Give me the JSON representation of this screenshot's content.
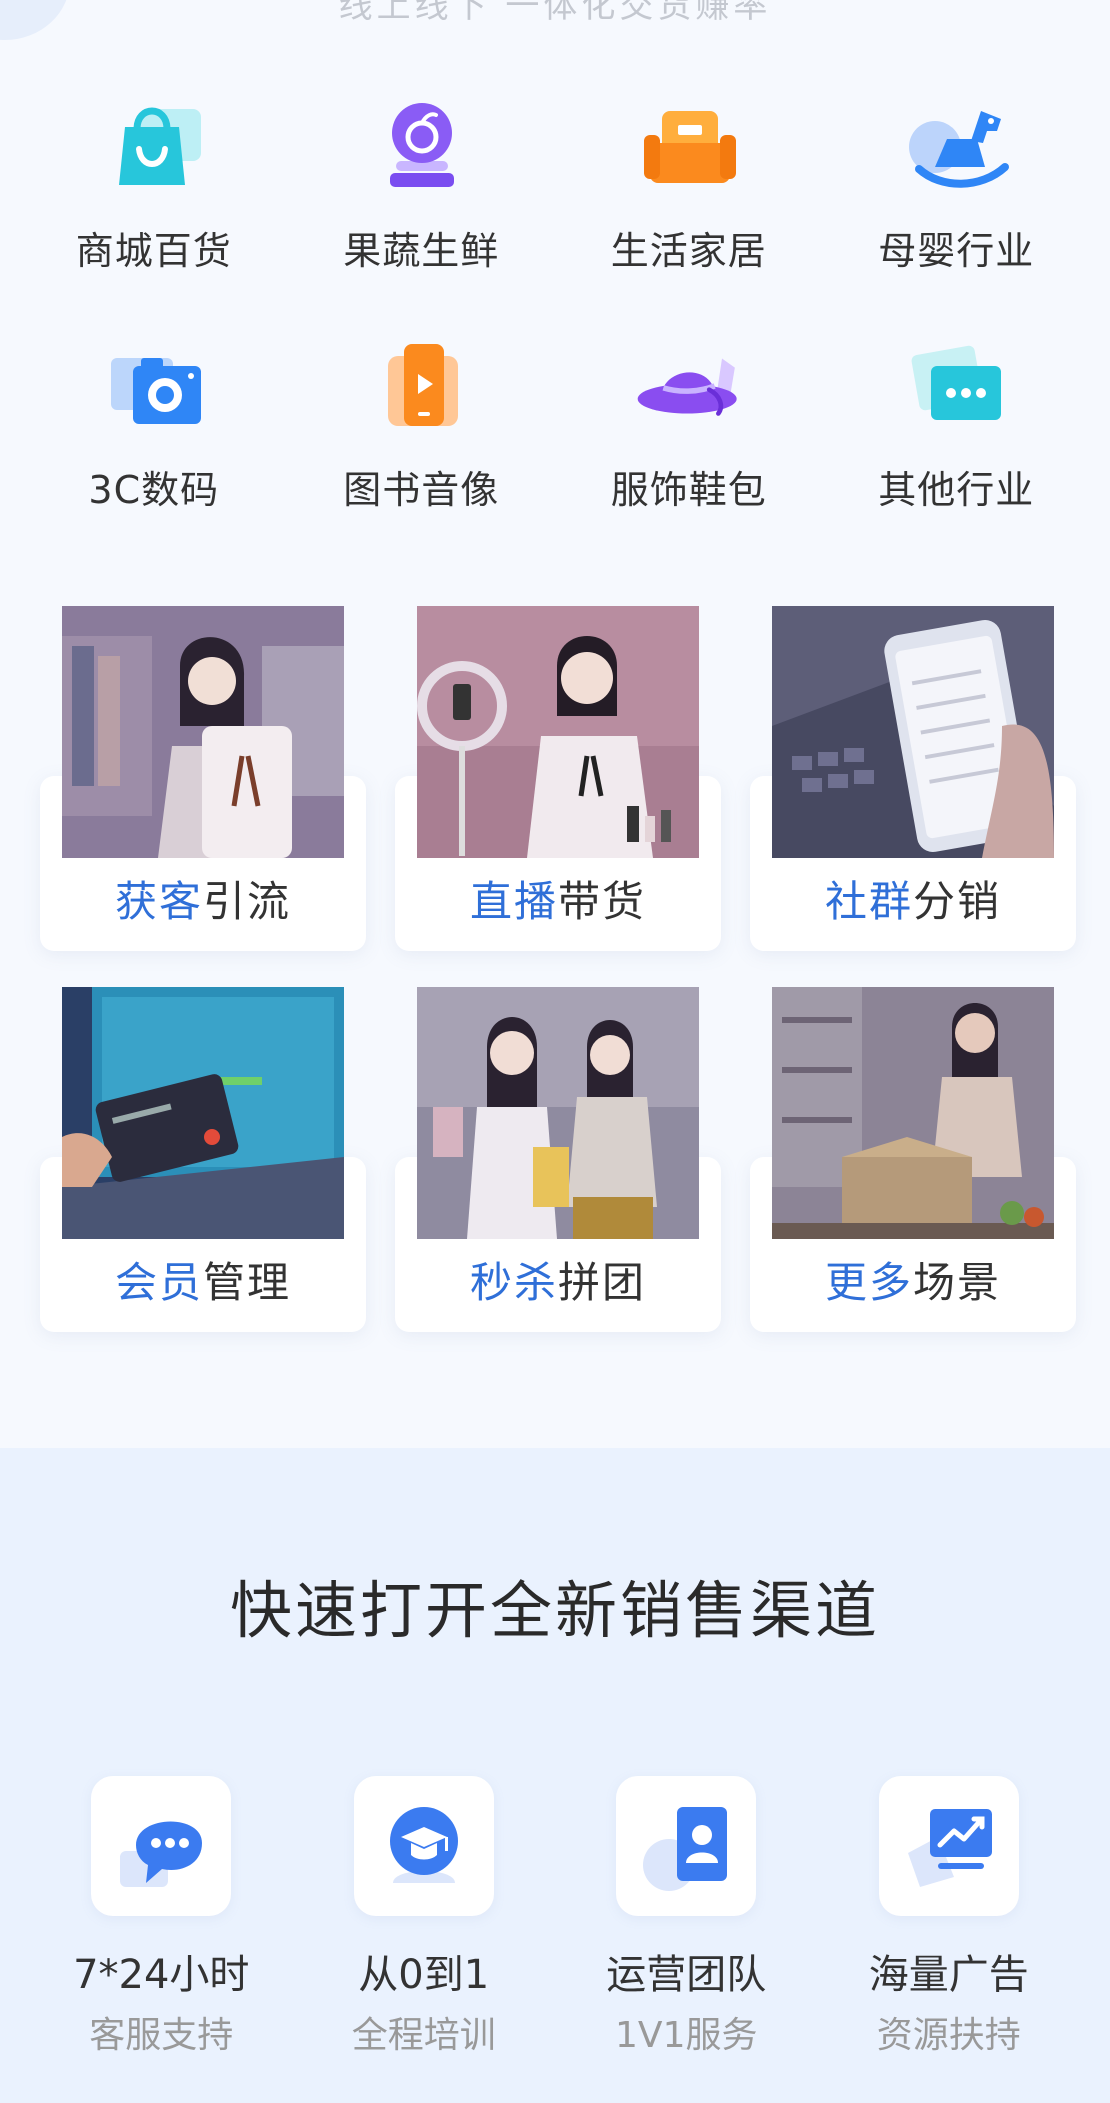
{
  "header": {
    "caption": "线上线下 一体化交货赚率"
  },
  "industries": [
    {
      "label": "商城百货",
      "icon": "shopping-bag-icon"
    },
    {
      "label": "果蔬生鲜",
      "icon": "fruit-icon"
    },
    {
      "label": "生活家居",
      "icon": "sofa-icon"
    },
    {
      "label": "母婴行业",
      "icon": "rocking-horse-icon"
    },
    {
      "label": "3C数码",
      "icon": "camera-icon"
    },
    {
      "label": "图书音像",
      "icon": "video-phone-icon"
    },
    {
      "label": "服饰鞋包",
      "icon": "hat-icon"
    },
    {
      "label": "其他行业",
      "icon": "more-chat-icon"
    }
  ],
  "scenes": [
    {
      "highlight": "获客",
      "rest": "引流",
      "image": "woman-with-clothes-photo"
    },
    {
      "highlight": "直播",
      "rest": "带货",
      "image": "livestream-host-photo"
    },
    {
      "highlight": "社群",
      "rest": "分销",
      "image": "phone-in-hand-photo"
    },
    {
      "highlight": "会员",
      "rest": "管理",
      "image": "card-payment-laptop-photo"
    },
    {
      "highlight": "秒杀",
      "rest": "拼团",
      "image": "shopping-friends-photo"
    },
    {
      "highlight": "更多",
      "rest": "场景",
      "image": "unboxing-kitchen-photo"
    }
  ],
  "channel": {
    "title": "快速打开全新销售渠道",
    "services": [
      {
        "title": "7*24小时",
        "subtitle": "客服支持",
        "icon": "chat-bubble-icon"
      },
      {
        "title": "从0到1",
        "subtitle": "全程培训",
        "icon": "graduation-cap-icon"
      },
      {
        "title": "运营团队",
        "subtitle": "1V1服务",
        "icon": "user-card-icon"
      },
      {
        "title": "海量广告",
        "subtitle": "资源扶持",
        "icon": "monitor-chart-icon"
      }
    ]
  },
  "colors": {
    "accent": "#2f6fd8",
    "background": "#f6f9fe",
    "bottomBackground": "#eaf2fe"
  }
}
